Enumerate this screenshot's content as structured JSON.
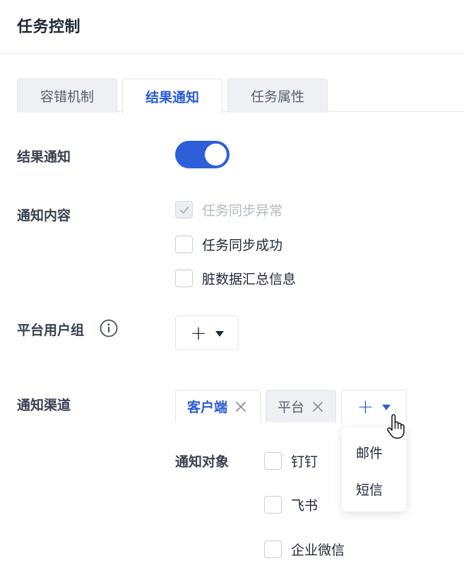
{
  "panel": {
    "title": "任务控制"
  },
  "tabs": [
    {
      "label": "容错机制",
      "active": false
    },
    {
      "label": "结果通知",
      "active": true
    },
    {
      "label": "任务属性",
      "active": false
    }
  ],
  "result_notify": {
    "label": "结果通知",
    "enabled": true
  },
  "notify_content": {
    "label": "通知内容",
    "options": [
      {
        "label": "任务同步异常",
        "checked": true,
        "disabled": true
      },
      {
        "label": "任务同步成功",
        "checked": false,
        "disabled": false
      },
      {
        "label": "脏数据汇总信息",
        "checked": false,
        "disabled": false
      }
    ]
  },
  "platform_group": {
    "label": "平台用户组",
    "icon": "info-icon"
  },
  "notify_channel": {
    "label": "通知渠道",
    "tabs": [
      {
        "label": "客户端",
        "active": true
      },
      {
        "label": "平台",
        "active": false
      }
    ],
    "dropdown_items": [
      "邮件",
      "短信"
    ],
    "target_label": "通知对象",
    "targets": [
      {
        "label": "钉钉",
        "checked": false
      },
      {
        "label": "飞书",
        "checked": false
      },
      {
        "label": "企业微信",
        "checked": false
      }
    ]
  },
  "colors": {
    "primary": "#2e5fd8",
    "tab_active_text": "#2a5bd7"
  }
}
